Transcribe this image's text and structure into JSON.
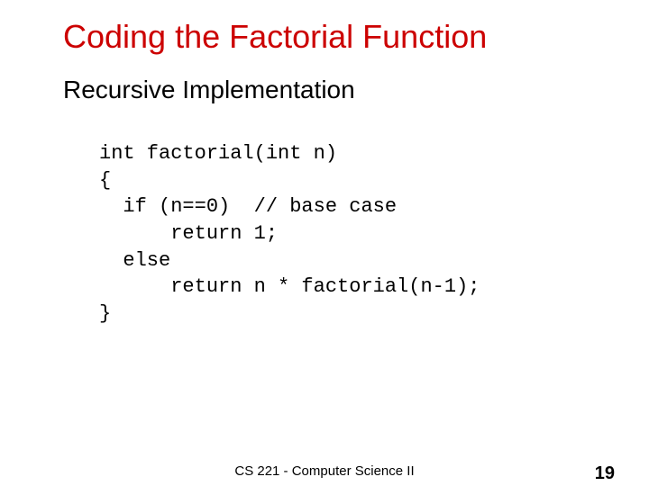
{
  "title": "Coding the Factorial Function",
  "subtitle": "Recursive Implementation",
  "code": {
    "l1": "int factorial(int n)",
    "l2": "{",
    "l3": "  if (n==0)  // base case",
    "l4": "      return 1;",
    "l5": "  else",
    "l6": "      return n * factorial(n-1);",
    "l7": "}"
  },
  "footer": "CS 221 - Computer Science II",
  "page_number": "19"
}
